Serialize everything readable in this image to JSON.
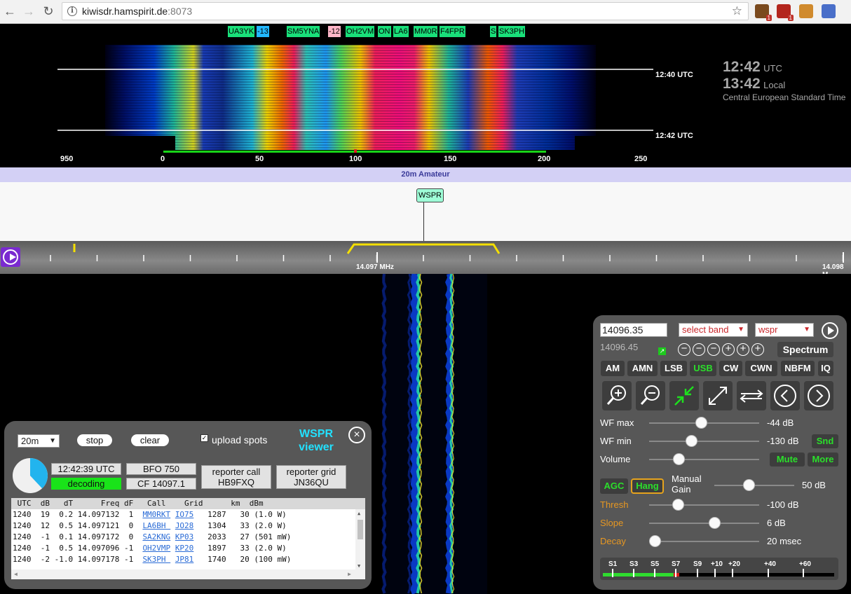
{
  "browser": {
    "url_host": "kiwisdr.hamspirit.de",
    "url_port": ":8073",
    "extensions": [
      {
        "name": "extension-1",
        "color": "#7a4a1e",
        "badge": "1"
      },
      {
        "name": "ublock-extension",
        "color": "#b3261e",
        "badge": "1"
      },
      {
        "name": "extension-3",
        "color": "#d08a2d",
        "badge": ""
      },
      {
        "name": "extension-4",
        "color": "#4a6fc9",
        "badge": ""
      }
    ]
  },
  "waterfall_top": {
    "spots": [
      {
        "label": "UA3YK",
        "color": "#19e07a"
      },
      {
        "label": "-13",
        "color": "#22b8ff"
      },
      {
        "label": "SM5YNA",
        "color": "#19e07a"
      },
      {
        "label": "-12",
        "color": "#ffb6c8"
      },
      {
        "label": "OH2VM",
        "color": "#19e07a"
      },
      {
        "label": "ON",
        "color": "#19e07a"
      },
      {
        "label": "LA6",
        "color": "#19e07a"
      },
      {
        "label": "MM0R",
        "color": "#19e07a"
      },
      {
        "label": "F4FPR",
        "color": "#19e07a"
      },
      {
        "label": "S",
        "color": "#19e07a"
      },
      {
        "label": "SK3PH",
        "color": "#19e07a"
      }
    ],
    "time_markers": [
      "12:40 UTC",
      "12:42 UTC"
    ],
    "scale_labels": [
      "950",
      "0",
      "50",
      "100",
      "150",
      "200",
      "250"
    ]
  },
  "clock": {
    "utc_time": "12:42",
    "utc_label": "UTC",
    "local_time": "13:42",
    "local_label": "Local",
    "timezone": "Central European Standard Time"
  },
  "band": {
    "name": "20m Amateur",
    "dx_label": "WSPR"
  },
  "scale": {
    "freq_left": "14.097 MHz",
    "freq_right": "14.098 M"
  },
  "wspr": {
    "band_select": "20m",
    "stop_label": "stop",
    "clear_label": "clear",
    "upload_label": "upload spots",
    "upload_checked": "✓",
    "title_line1": "WSPR",
    "title_line2": "viewer",
    "close_glyph": "×",
    "time": "12:42:39 UTC",
    "status": "decoding",
    "bfo": "BFO 750",
    "cf": "CF 14097.1",
    "reporter_call_label": "reporter call",
    "reporter_call": "HB9FXQ",
    "reporter_grid_label": "reporter grid",
    "reporter_grid": "JN36QU",
    "progress_fraction": 0.38,
    "table_header": " UTC  dB   dT      Freq dF   Call    Grid      km  dBm",
    "rows": [
      {
        "utc": "1240",
        "db": "19",
        "dt": "0.2",
        "freq": "14.097132",
        "df": "1",
        "call": "MM0RKT",
        "grid": "IO75",
        "km": "1287",
        "dbm": "30",
        "pwr": "(1.0 W)"
      },
      {
        "utc": "1240",
        "db": "12",
        "dt": "0.5",
        "freq": "14.097121",
        "df": "0",
        "call": "LA6BH",
        "grid": "JO28",
        "km": "1304",
        "dbm": "33",
        "pwr": "(2.0 W)"
      },
      {
        "utc": "1240",
        "db": "-1",
        "dt": "0.1",
        "freq": "14.097172",
        "df": "0",
        "call": "SA2KNG",
        "grid": "KP03",
        "km": "2033",
        "dbm": "27",
        "pwr": "(501 mW)"
      },
      {
        "utc": "1240",
        "db": "-1",
        "dt": "0.5",
        "freq": "14.097096",
        "df": "-1",
        "call": "OH2VMP",
        "grid": "KP20",
        "km": "1897",
        "dbm": "33",
        "pwr": "(2.0 W)"
      },
      {
        "utc": "1240",
        "db": "-2",
        "dt": "-1.0",
        "freq": "14.097178",
        "df": "-1",
        "call": "SK3PH",
        "grid": "JP81",
        "km": "1740",
        "dbm": "20",
        "pwr": "(100 mW)"
      }
    ]
  },
  "control": {
    "freq_input": "14096.35",
    "freq_sub": "14096.45",
    "band_select": "select band",
    "ext_select": "wspr",
    "spectrum_label": "Spectrum",
    "modes": [
      "AM",
      "AMN",
      "LSB",
      "USB",
      "CW",
      "CWN",
      "NBFM",
      "IQ"
    ],
    "active_mode": "USB",
    "sliders": [
      {
        "label": "WF max",
        "value": "-44 dB",
        "fraction": 0.47,
        "orange": false
      },
      {
        "label": "WF min",
        "value": "-130 dB",
        "fraction": 0.38,
        "orange": false
      },
      {
        "label": "Volume",
        "value": "",
        "fraction": 0.27,
        "orange": false
      },
      {
        "label": "Thresh",
        "value": "-100 dB",
        "fraction": 0.26,
        "orange": true
      },
      {
        "label": "Slope",
        "value": "6 dB",
        "fraction": 0.59,
        "orange": true
      },
      {
        "label": "Decay",
        "value": "20 msec",
        "fraction": 0.05,
        "orange": true
      }
    ],
    "snd_label": "Snd",
    "mute_label": "Mute",
    "more_label": "More",
    "agc_label": "AGC",
    "hang_label": "Hang",
    "manual_gain_line1": "Manual",
    "manual_gain_line2": "Gain",
    "manual_gain_value": "50 dB",
    "manual_gain_fraction": 0.43,
    "smeter_labels": [
      "S1",
      "S3",
      "S5",
      "S7",
      "S9",
      "+10",
      "+20",
      "+40",
      "+60"
    ],
    "smeter_level_fraction": 0.33
  }
}
